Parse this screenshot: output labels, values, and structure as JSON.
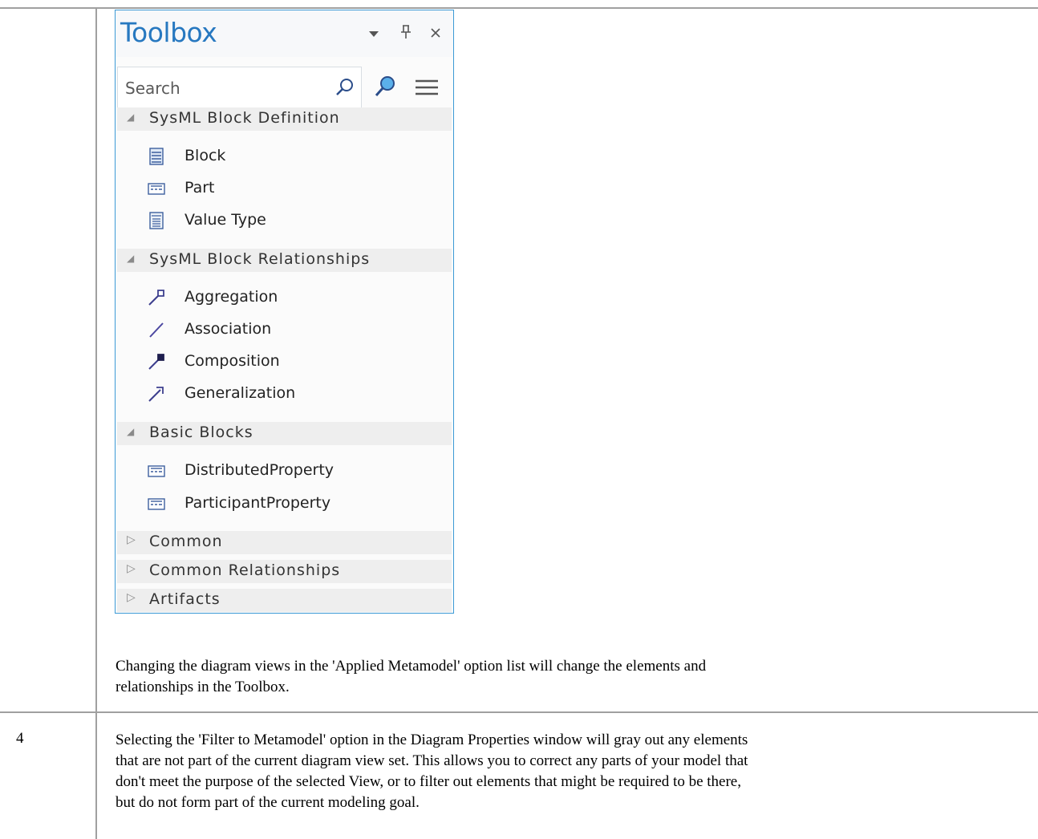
{
  "toolbox": {
    "title": "Toolbox",
    "search_placeholder": "Search",
    "groups": [
      {
        "label": "SysML Block Definition",
        "expanded": true,
        "items": [
          {
            "label": "Block",
            "icon": "block-icon"
          },
          {
            "label": "Part",
            "icon": "part-icon"
          },
          {
            "label": "Value Type",
            "icon": "value-type-icon"
          }
        ]
      },
      {
        "label": "SysML Block Relationships",
        "expanded": true,
        "items": [
          {
            "label": "Aggregation",
            "icon": "aggregation-icon"
          },
          {
            "label": "Association",
            "icon": "association-icon"
          },
          {
            "label": "Composition",
            "icon": "composition-icon"
          },
          {
            "label": "Generalization",
            "icon": "generalization-icon"
          }
        ]
      },
      {
        "label": "Basic Blocks",
        "expanded": true,
        "items": [
          {
            "label": "DistributedProperty",
            "icon": "property-icon"
          },
          {
            "label": "ParticipantProperty",
            "icon": "property-icon"
          }
        ]
      },
      {
        "label": "Common",
        "expanded": false,
        "items": []
      },
      {
        "label": "Common Relationships",
        "expanded": false,
        "items": []
      },
      {
        "label": "Artifacts",
        "expanded": false,
        "items": []
      }
    ],
    "colors": {
      "accent": "#2778c0",
      "border": "#3c9ad6",
      "group_bg": "#eeeeee"
    }
  },
  "doc": {
    "paragraph_1": {
      "line_1": "Changing the diagram views in the 'Applied Metamodel' option list will change the elements and",
      "line_2": "relationships in the Toolbox."
    },
    "step_number": "4",
    "paragraph_2": {
      "line_1": "Selecting the 'Filter to Metamodel' option in the Diagram Properties window will gray out any elements",
      "line_2": "that are not part of the current diagram view set. This allows you to correct any parts of your model that",
      "line_3": "don't meet the purpose of the selected View, or to filter out elements that might be required to be there,",
      "line_4": "but do not form part of the current modeling goal."
    }
  }
}
